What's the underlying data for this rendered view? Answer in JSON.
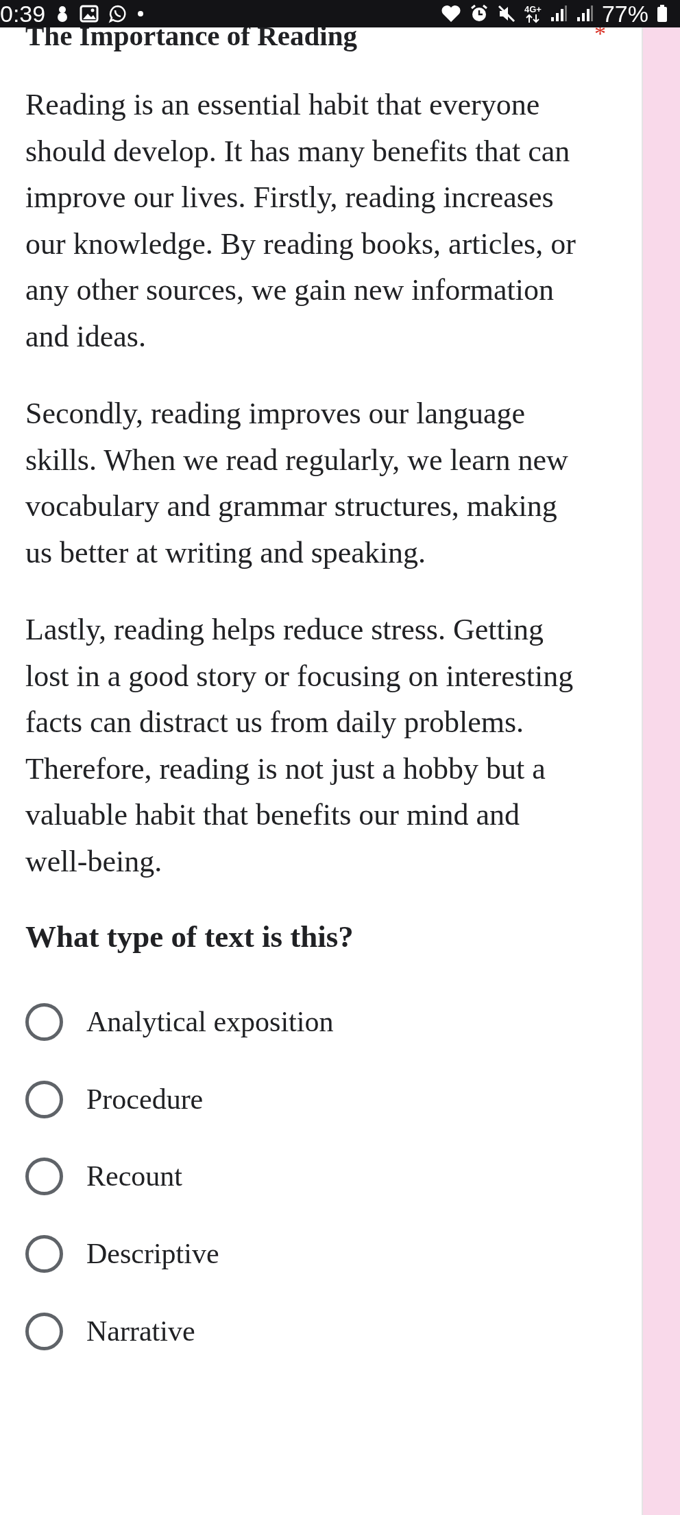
{
  "status_bar": {
    "time": "0:39",
    "network": "4G+",
    "battery": "77%"
  },
  "question": {
    "title": "The Importance of Reading",
    "required_mark": "*",
    "paragraphs": [
      "Reading is an essential habit that everyone should develop. It has many benefits that can improve our lives. Firstly, reading increases our knowledge. By reading books, articles, or any other sources, we gain new information and ideas.",
      "Secondly, reading improves our language skills. When we read regularly, we learn new vocabulary and grammar structures, making us better at writing and speaking.",
      "Lastly, reading helps reduce stress. Getting lost in a good story or focusing on interesting facts can distract us from daily problems. Therefore, reading is not just a hobby but a valuable habit that benefits our mind and well-being."
    ],
    "prompt": "What type of text is this?",
    "options": [
      {
        "label": "Analytical exposition",
        "selected": false
      },
      {
        "label": "Procedure",
        "selected": false
      },
      {
        "label": "Recount",
        "selected": false
      },
      {
        "label": "Descriptive",
        "selected": false
      },
      {
        "label": "Narrative",
        "selected": false
      }
    ]
  }
}
